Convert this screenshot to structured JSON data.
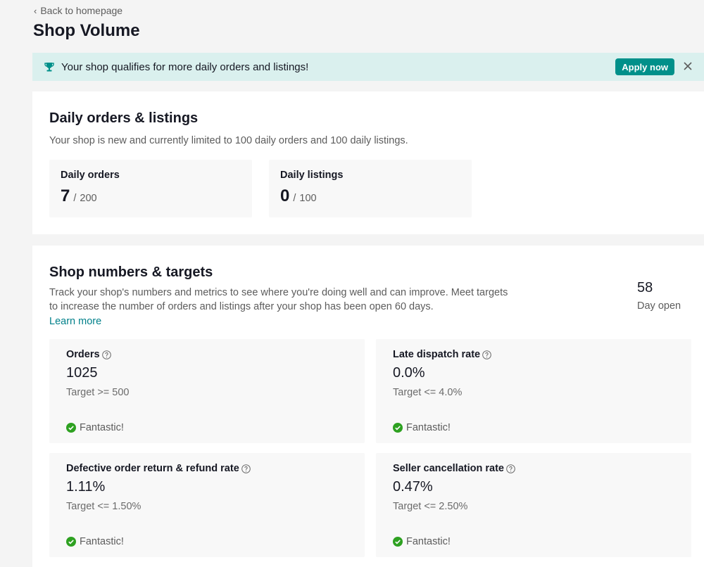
{
  "nav": {
    "back_label": "Back to homepage"
  },
  "page": {
    "title": "Shop Volume"
  },
  "banner": {
    "icon": "trophy-icon",
    "text": "Your shop qualifies for more daily orders and listings!",
    "apply_label": "Apply now",
    "close_icon": "close-icon",
    "accent_color": "#00908a",
    "background_color": "#daf0ee"
  },
  "daily": {
    "title": "Daily orders & listings",
    "description": "Your shop is new and currently limited to 100 daily orders and 100 daily listings.",
    "orders": {
      "label": "Daily orders",
      "value": "7",
      "separator": "/",
      "limit": "200"
    },
    "listings": {
      "label": "Daily listings",
      "value": "0",
      "separator": "/",
      "limit": "100"
    }
  },
  "targets": {
    "title": "Shop numbers & targets",
    "description_line1": "Track your shop's numbers and metrics to see where you're doing well and can improve. Meet targets",
    "description_line2": "to increase the number of orders and listings after your shop has been open 60 days.",
    "learn_more": "Learn more",
    "days_open": {
      "value": "58",
      "label": "Day open"
    },
    "metrics": [
      {
        "label": "Orders",
        "value": "1025",
        "target": "Target >= 500",
        "status": "Fantastic!"
      },
      {
        "label": "Late dispatch rate",
        "value": "0.0%",
        "target": "Target <= 4.0%",
        "status": "Fantastic!"
      },
      {
        "label": "Defective order return & refund rate",
        "value": "1.11%",
        "target": "Target <= 1.50%",
        "status": "Fantastic!"
      },
      {
        "label": "Seller cancellation rate",
        "value": "0.47%",
        "target": "Target <= 2.50%",
        "status": "Fantastic!"
      }
    ],
    "status_color": "#2ea121"
  }
}
